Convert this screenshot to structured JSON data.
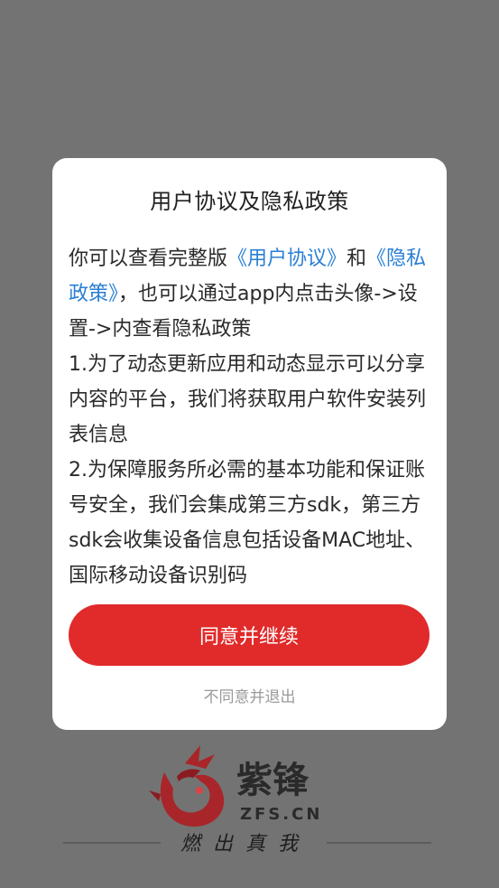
{
  "dialog": {
    "title": "用户协议及隐私政策",
    "intro_prefix": "你可以查看完整版",
    "user_agreement_link": "《用户协议》",
    "and": "和",
    "privacy_policy_link": "《隐私政策》",
    "intro_suffix": "，也可以通过app内点击头像->设置->内查看隐私政策",
    "item1": "1.为了动态更新应用和动态显示可以分享内容的平台，我们将获取用户软件安装列表信息",
    "item2": "2.为保障服务所必需的基本功能和保证账号安全，我们会集成第三方sdk，第三方sdk会收集设备信息包括设备MAC地址、国际移动设备识别码",
    "agree_button": "同意并继续",
    "disagree_button": "不同意并退出"
  },
  "brand": {
    "logo_name": "紫锋",
    "domain": "ZFS.CN",
    "slogan": "燃出真我"
  },
  "colors": {
    "overlay": "#737373",
    "primary_red": "#e12a2a",
    "link_blue": "#2a7fd4"
  }
}
